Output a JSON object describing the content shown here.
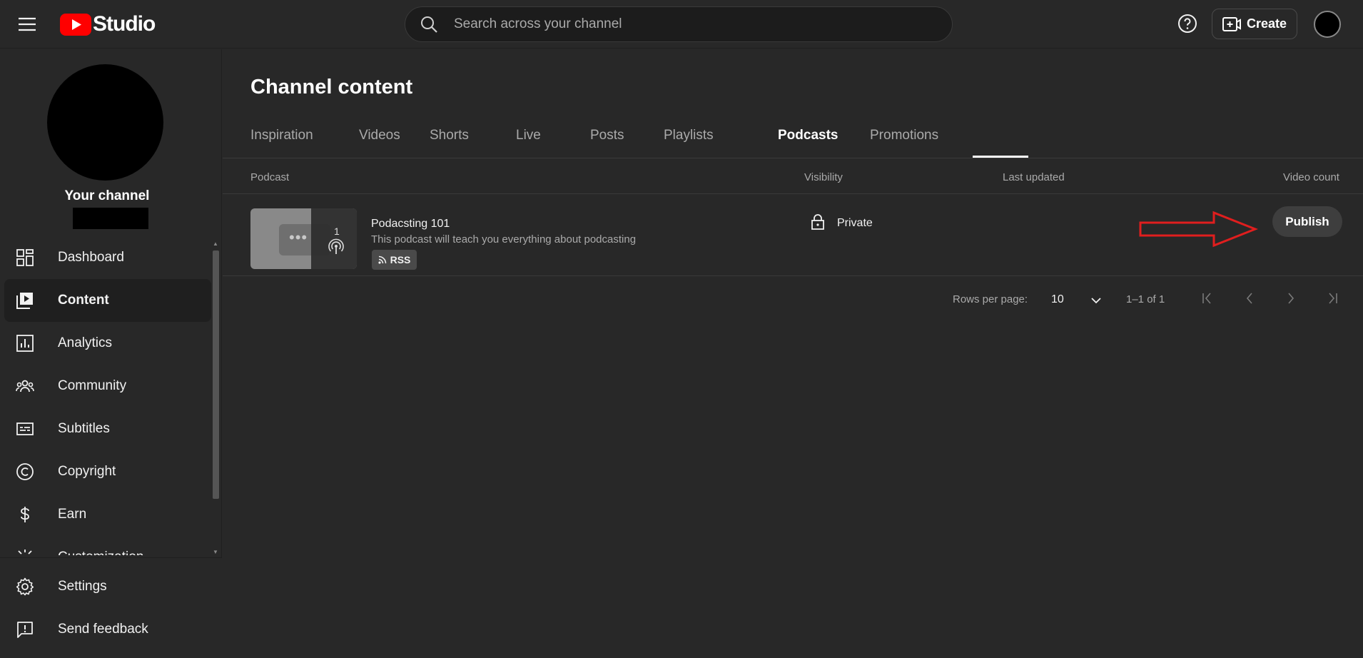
{
  "header": {
    "logo_text": "Studio",
    "search_placeholder": "Search across your channel",
    "create_label": "Create"
  },
  "sidebar": {
    "channel_label": "Your channel",
    "items": [
      {
        "label": "Dashboard",
        "icon": "dashboard-icon"
      },
      {
        "label": "Content",
        "icon": "content-icon",
        "active": true
      },
      {
        "label": "Analytics",
        "icon": "analytics-icon"
      },
      {
        "label": "Community",
        "icon": "community-icon"
      },
      {
        "label": "Subtitles",
        "icon": "subtitles-icon"
      },
      {
        "label": "Copyright",
        "icon": "copyright-icon"
      },
      {
        "label": "Earn",
        "icon": "earn-icon"
      },
      {
        "label": "Customization",
        "icon": "customization-icon"
      }
    ],
    "bottom_items": [
      {
        "label": "Settings",
        "icon": "gear-icon"
      },
      {
        "label": "Send feedback",
        "icon": "feedback-icon"
      }
    ]
  },
  "main": {
    "title": "Channel content",
    "tabs": [
      {
        "label": "Inspiration"
      },
      {
        "label": "Videos"
      },
      {
        "label": "Shorts"
      },
      {
        "label": "Live"
      },
      {
        "label": "Posts"
      },
      {
        "label": "Playlists"
      },
      {
        "label": "Podcasts",
        "active": true
      },
      {
        "label": "Promotions"
      }
    ],
    "table": {
      "columns": [
        "Podcast",
        "Visibility",
        "Last updated",
        "Video count"
      ],
      "rows": [
        {
          "title": "Podacsting 101",
          "description": "This podcast will teach you everything about podcasting",
          "badge": "RSS",
          "thumb_count": "1",
          "visibility": "Private",
          "last_updated": "",
          "action_label": "Publish"
        }
      ]
    },
    "pagination": {
      "rows_per_page_label": "Rows per page:",
      "rows_per_page_value": "10",
      "range": "1–1 of 1"
    }
  },
  "colors": {
    "background": "#282828",
    "brand_red": "#ff0000",
    "annotation_arrow": "#e01e1e"
  }
}
